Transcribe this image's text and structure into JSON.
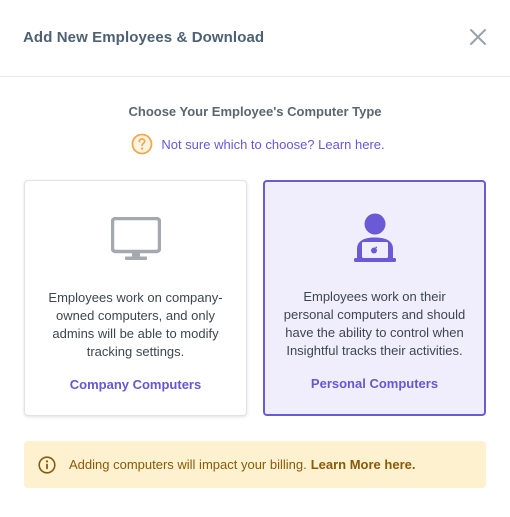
{
  "modal": {
    "title": "Add New Employees & Download"
  },
  "intro": {
    "heading": "Choose Your Employee's Computer Type",
    "help_link": "Not sure which to choose? Learn here."
  },
  "cards": [
    {
      "icon": "monitor-icon",
      "description": "Employees work on company-owned computers, and only admins will be able to modify tracking settings.",
      "label": "Company Computers",
      "selected": false
    },
    {
      "icon": "user-laptop-icon",
      "description": "Employees work on their personal computers and should have the ability to control when Insightful tracks their activities.",
      "label": "Personal Computers",
      "selected": true
    }
  ],
  "notice": {
    "text": "Adding computers will impact your billing.",
    "link": "Learn More here."
  },
  "colors": {
    "accent": "#6b5ad6",
    "selected_bg": "#f0eefc",
    "notice_bg": "#fdf1cf",
    "notice_text": "#8a5a08",
    "help_icon": "#f0a94a"
  }
}
